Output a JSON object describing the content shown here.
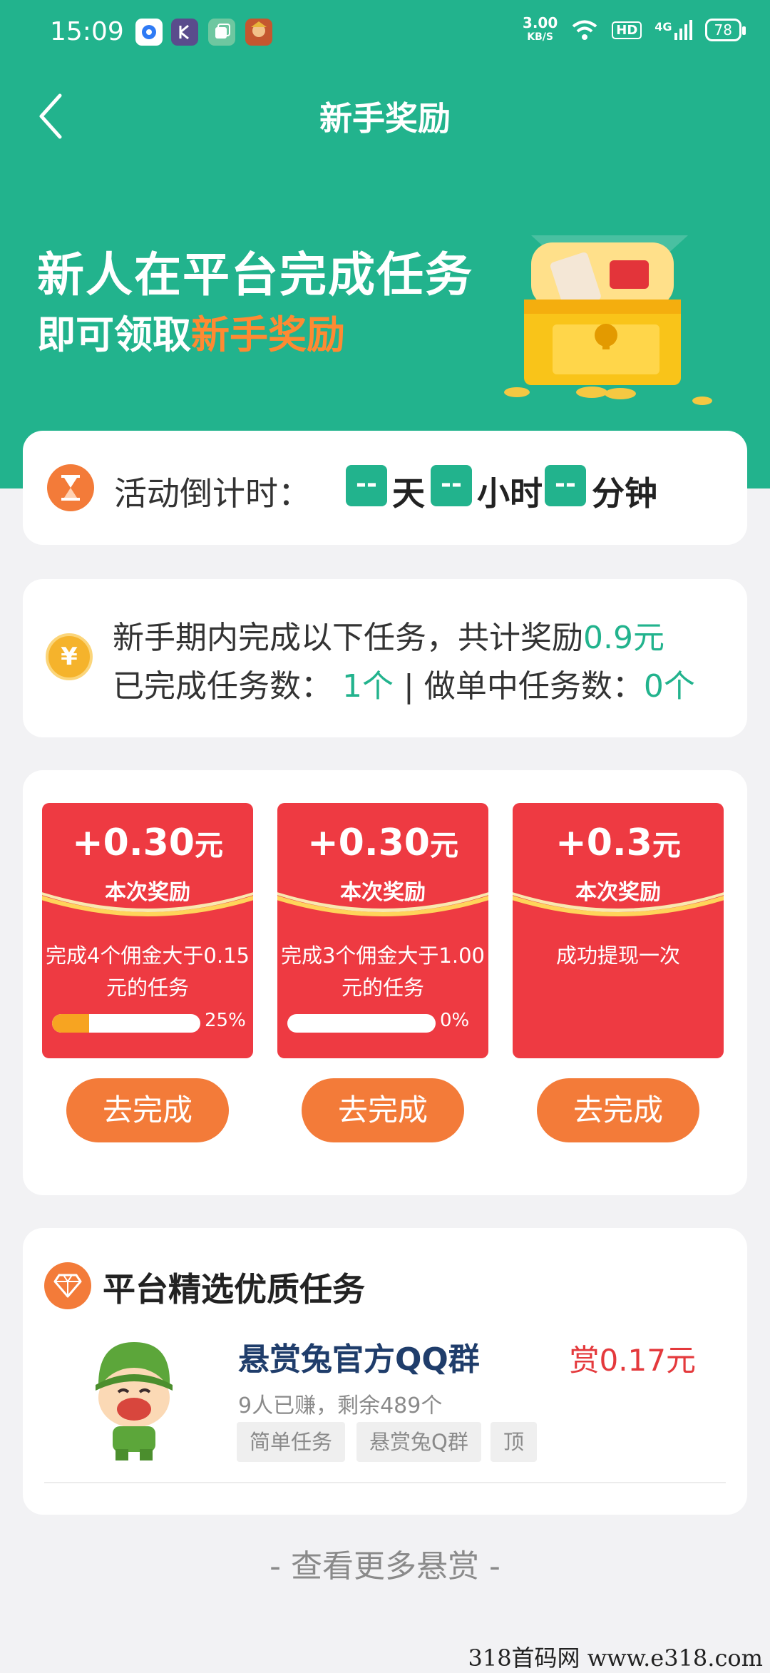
{
  "status_bar": {
    "time": "15:09",
    "net_speed": "3.00",
    "net_unit": "KB/S",
    "hd": "HD",
    "network": "4G",
    "battery": "78"
  },
  "header": {
    "title": "新手奖励",
    "banner_line1": "新人在平台完成任务",
    "banner_line2_prefix": "即可领取",
    "banner_line2_highlight": "新手奖励"
  },
  "countdown": {
    "label": "活动倒计时：",
    "days_value": "--",
    "days_unit": "天",
    "hours_value": "--",
    "hours_unit": "小时",
    "minutes_value": "--",
    "minutes_unit": "分钟"
  },
  "summary": {
    "yen_symbol": "¥",
    "line1_prefix": "新手期内完成以下任务，共计奖励",
    "line1_amount": "0.9元",
    "completed_label": "已完成任务数：",
    "completed_value": "1个",
    "separator": "|",
    "inprogress_label": "做单中任务数：",
    "inprogress_value": "0个"
  },
  "rewards": [
    {
      "amount": "+0.30",
      "unit": "元",
      "label": "本次奖励",
      "desc_line1": "完成4个佣金大于0.15",
      "desc_line2": "元的任务",
      "progress": 0.25,
      "progress_text": "25%",
      "button": "去完成"
    },
    {
      "amount": "+0.30",
      "unit": "元",
      "label": "本次奖励",
      "desc_line1": "完成3个佣金大于1.00",
      "desc_line2": "元的任务",
      "progress": 0.0,
      "progress_text": "0%",
      "button": "去完成"
    },
    {
      "amount": "+0.3",
      "unit": "元",
      "label": "本次奖励",
      "desc_line1": "成功提现一次",
      "desc_line2": "",
      "button": "去完成"
    }
  ],
  "featured": {
    "title": "平台精选优质任务",
    "task": {
      "name": "悬赏兔官方QQ群",
      "stats": "9人已赚，剩余489个",
      "reward": "赏0.17元",
      "tags": [
        "简单任务",
        "悬赏兔Q群",
        "顶"
      ]
    }
  },
  "more_link": "- 查看更多悬赏 -",
  "watermark": "318首码网 www.e318.com",
  "colors": {
    "brand_green": "#22B38D",
    "orange": "#F37B39",
    "tile_red": "#EE3A42",
    "reward_red": "#E4393C",
    "gold": "#F5B32C"
  }
}
